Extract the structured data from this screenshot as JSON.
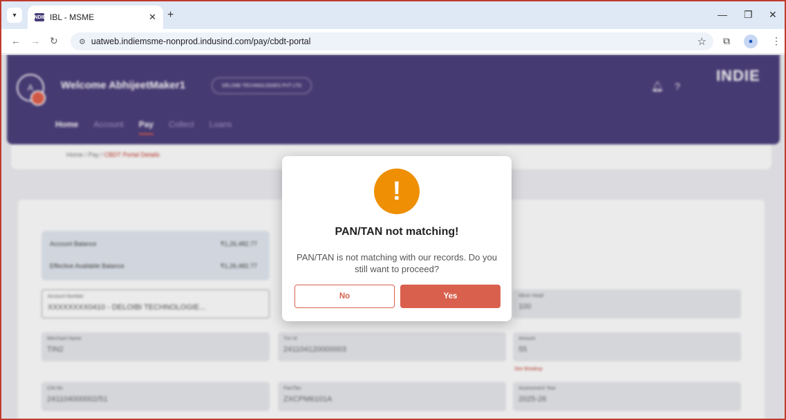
{
  "browser": {
    "tab_title": "IBL - MSME",
    "favicon_text": "INDIE",
    "url": "uatweb.indiemsme-nonprod.indusind.com/pay/cbdt-portal"
  },
  "header": {
    "avatar_initials": "A",
    "welcome": "Welcome AbhijeetMaker1",
    "company": "DELOIBI TECHNOLOGIES PVT LTD",
    "brand": "INDIE",
    "nav": [
      {
        "label": "Home"
      },
      {
        "label": "Account"
      },
      {
        "label": "Pay"
      },
      {
        "label": "Collect"
      },
      {
        "label": "Loans"
      }
    ]
  },
  "breadcrumb": {
    "home": "Home",
    "sep1": "/",
    "pay": "Pay",
    "sep2": "/",
    "current": "CBDT Portal Details"
  },
  "balances": {
    "account_balance_label": "Account Balance",
    "account_balance_value": "₹1,26,482.77",
    "effective_label": "Effective Available Balance",
    "effective_value": "₹1,26,482.77"
  },
  "form": {
    "account_number_label": "Account Number",
    "account_number_value": "XXXXXXXX0410 - DELOIBI TECHNOLOGIE...",
    "minor_head_label": "Minor Head",
    "minor_head_value": "100",
    "merchant_name_label": "Merchant Name",
    "merchant_name_value": "TIN2",
    "txn_id_label": "Txn Id",
    "txn_id_value": "241104120000003",
    "amount_label": "Amount",
    "amount_value": "55",
    "see_breakup": "See Breakup",
    "cin_label": "CIN No",
    "cin_value": "241104000002/51",
    "pan_tan_label": "Pan/Tan",
    "pan_tan_value": "ZXCPM6101A",
    "assessment_year_label": "Assessment Year",
    "assessment_year_value": "2025-26"
  },
  "dialog": {
    "icon_glyph": "!",
    "title": "PAN/TAN not matching!",
    "message": "PAN/TAN is not matching with our records. Do you still want to proceed?",
    "no_label": "No",
    "yes_label": "Yes",
    "accent_color": "#ee8f04",
    "button_color": "#d9604d"
  }
}
